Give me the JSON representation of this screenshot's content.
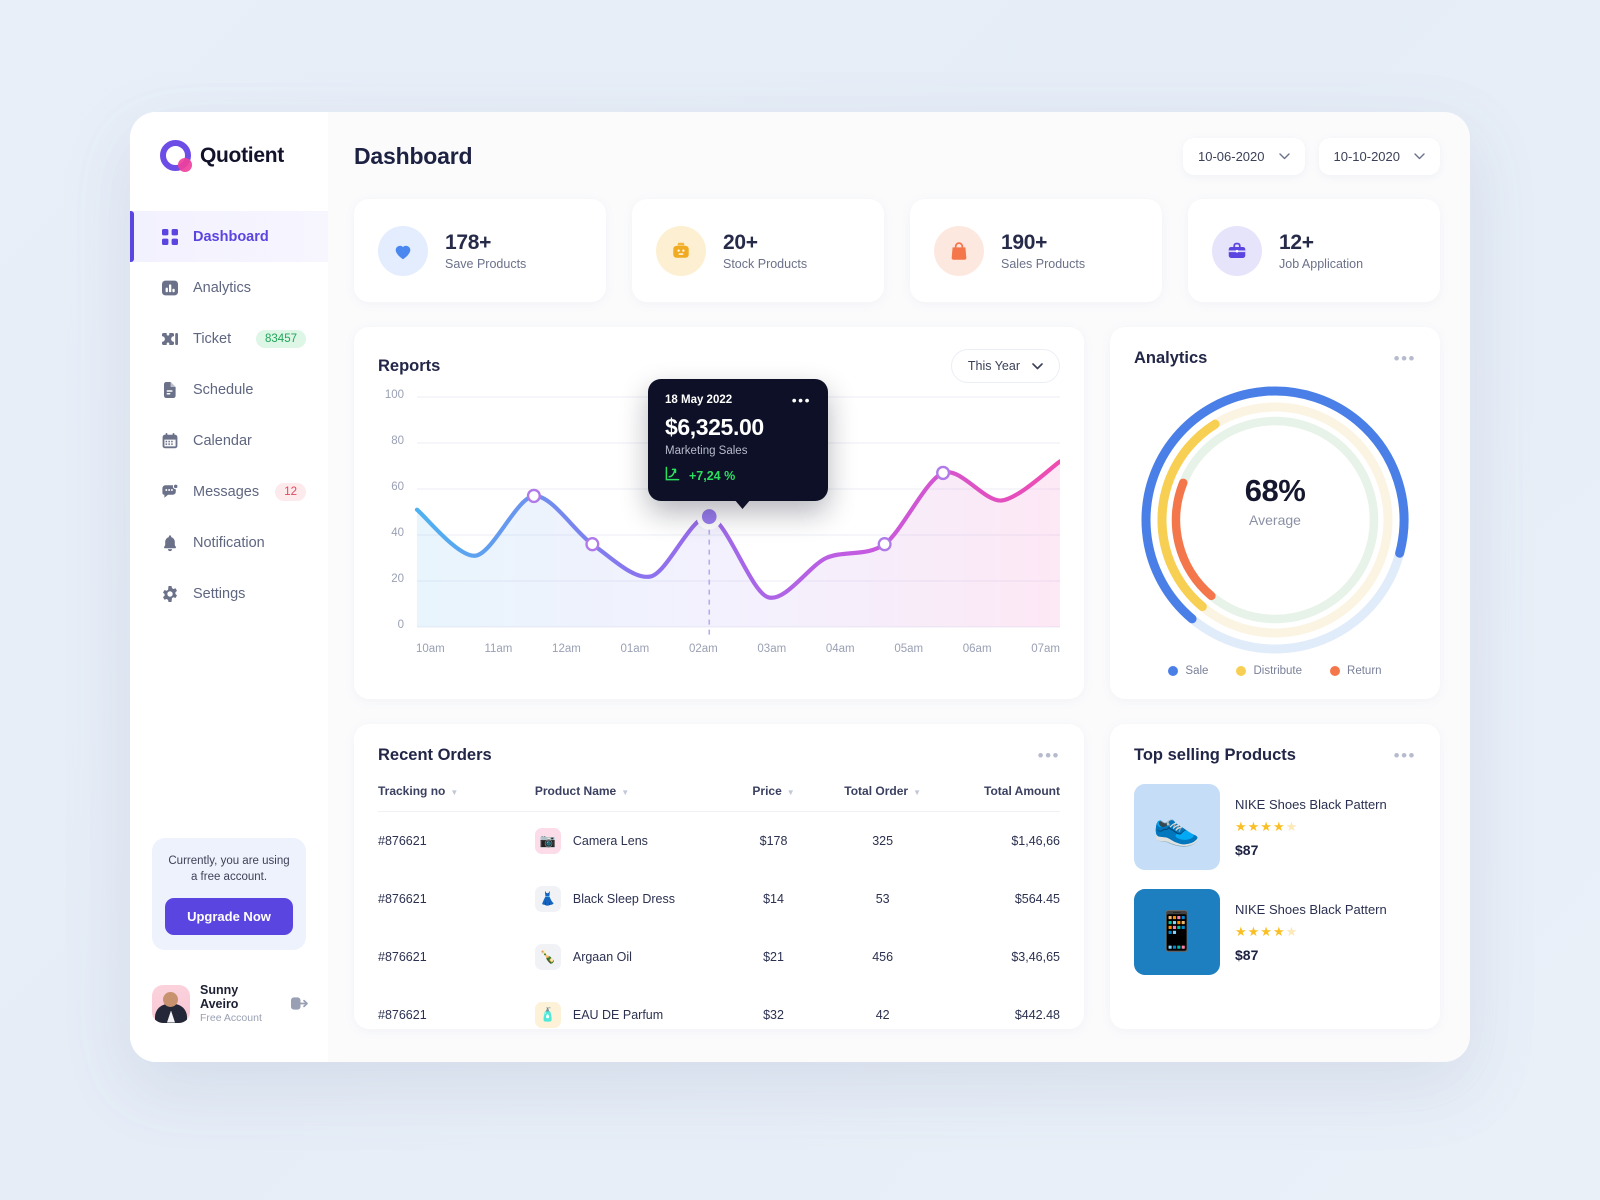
{
  "brand": {
    "name": "Quotient",
    "logo_icon": "quotient-logo-icon"
  },
  "sidebar": {
    "items": [
      {
        "label": "Dashboard",
        "icon": "grid-icon",
        "active": true
      },
      {
        "label": "Analytics",
        "icon": "bar-chart-icon",
        "active": false
      },
      {
        "label": "Ticket",
        "icon": "ticket-icon",
        "active": false,
        "badge": "83457",
        "badge_color": "green"
      },
      {
        "label": "Schedule",
        "icon": "document-icon",
        "active": false
      },
      {
        "label": "Calendar",
        "icon": "calendar-icon",
        "active": false
      },
      {
        "label": "Messages",
        "icon": "chat-icon",
        "active": false,
        "badge": "12",
        "badge_color": "red"
      },
      {
        "label": "Notification",
        "icon": "bell-icon",
        "active": false
      },
      {
        "label": "Settings",
        "icon": "gear-icon",
        "active": false
      }
    ],
    "upgrade": {
      "text": "Currently, you are using a free account.",
      "button_label": "Upgrade Now"
    },
    "user": {
      "name": "Sunny Aveiro",
      "plan": "Free Account",
      "logout_icon": "logout-icon"
    }
  },
  "header": {
    "title": "Dashboard",
    "date_from": "10-06-2020",
    "date_to": "10-10-2020"
  },
  "stats": [
    {
      "value": "178+",
      "label": "Save Products",
      "icon": "heart-icon",
      "icon_bg": "#e3edfd",
      "icon_color": "#4a88ef"
    },
    {
      "value": "20+",
      "label": "Stock Products",
      "icon": "package-icon",
      "icon_bg": "#fdf0d2",
      "icon_color": "#f0ab22"
    },
    {
      "value": "190+",
      "label": "Sales Products",
      "icon": "bag-icon",
      "icon_bg": "#fde8e0",
      "icon_color": "#f4764b"
    },
    {
      "value": "12+",
      "label": "Job Application",
      "icon": "briefcase-icon",
      "icon_bg": "#e6e4fb",
      "icon_color": "#5b45e0"
    }
  ],
  "reports": {
    "title": "Reports",
    "range_label": "This Year",
    "tooltip": {
      "date": "18 May 2022",
      "amount": "$6,325.00",
      "subtitle": "Marketing Sales",
      "change": "+7,24 %",
      "change_color": "#2ce05f",
      "trend_icon": "trend-up-icon"
    }
  },
  "analytics": {
    "title": "Analytics",
    "center_value": "68%",
    "center_label": "Average",
    "legend": [
      {
        "label": "Sale",
        "color": "#4a7fe8"
      },
      {
        "label": "Distribute",
        "color": "#f7c council"
      },
      {
        "label": "Return",
        "color": "#f4764b"
      }
    ]
  },
  "orders": {
    "title": "Recent Orders",
    "columns": [
      "Tracking no",
      "Product Name",
      "Price",
      "Total Order",
      "Total Amount"
    ],
    "rows": [
      {
        "tracking": "#876621",
        "product": "Camera Lens",
        "price": "$178",
        "total_order": "325",
        "total_amount": "$1,46,66",
        "thumb": "camera-icon",
        "thumb_bg": "#fbdce8"
      },
      {
        "tracking": "#876621",
        "product": "Black Sleep Dress",
        "price": "$14",
        "total_order": "53",
        "total_amount": "$564.45",
        "thumb": "dress-icon",
        "thumb_bg": "#f1f2f6"
      },
      {
        "tracking": "#876621",
        "product": "Argaan Oil",
        "price": "$21",
        "total_order": "456",
        "total_amount": "$3,46,65",
        "thumb": "bottle-icon",
        "thumb_bg": "#f1f2f6"
      },
      {
        "tracking": "#876621",
        "product": "EAU DE Parfum",
        "price": "$32",
        "total_order": "42",
        "total_amount": "$442.48",
        "thumb": "perfume-icon",
        "thumb_bg": "#fdf2d8"
      }
    ]
  },
  "top_selling": {
    "title": "Top selling Products",
    "items": [
      {
        "name": "NIKE Shoes Black Pattern",
        "price": "$87",
        "stars": "★★★★",
        "star_empty": "★",
        "thumb": "shoe-icon",
        "thumb_bg": "#c5ddf7"
      },
      {
        "name": "NIKE Shoes Black Pattern",
        "price": "$87",
        "stars": "★★★★",
        "star_empty": "★",
        "thumb": "phone-icon",
        "thumb_bg": "#1e7fc0"
      }
    ]
  },
  "chart_data": {
    "type": "area",
    "title": "Reports",
    "x": [
      "10am",
      "11am",
      "12am",
      "01am",
      "02am",
      "03am",
      "04am",
      "05am",
      "06am",
      "07am"
    ],
    "xlabel": "",
    "ylabel": "",
    "ylim": [
      0,
      100
    ],
    "yticks": [
      0,
      20,
      40,
      60,
      80,
      100
    ],
    "grid": true,
    "legend_position": "none",
    "series": [
      {
        "name": "Marketing Sales",
        "values": [
          51,
          31,
          57,
          36,
          22,
          48,
          13,
          30,
          36,
          67,
          55,
          72
        ],
        "markers": [
          {
            "index": 2,
            "value": 57,
            "style": "hollow"
          },
          {
            "index": 3,
            "value": 36,
            "style": "hollow"
          },
          {
            "index": 5,
            "value": 48,
            "style": "active"
          },
          {
            "index": 8,
            "value": 36,
            "style": "hollow"
          },
          {
            "index": 9,
            "value": 67,
            "style": "hollow"
          }
        ],
        "gradient": [
          "#4eb2f0",
          "#8b72ee",
          "#e457d4",
          "#f04bb0"
        ]
      }
    ]
  },
  "donut_data": {
    "type": "pie",
    "title": "Analytics",
    "center_value": "68%",
    "center_label": "Average",
    "rings": [
      {
        "name": "Sale",
        "percent": 68,
        "color": "#4a7fe8",
        "track": "#e1ecfa"
      },
      {
        "name": "Distribute",
        "percent": 30,
        "color": "#f7cf52",
        "track": "#fbf4e2"
      },
      {
        "name": "Return",
        "percent": 20,
        "color": "#f4764b",
        "track": "#e7f2e8"
      }
    ]
  }
}
